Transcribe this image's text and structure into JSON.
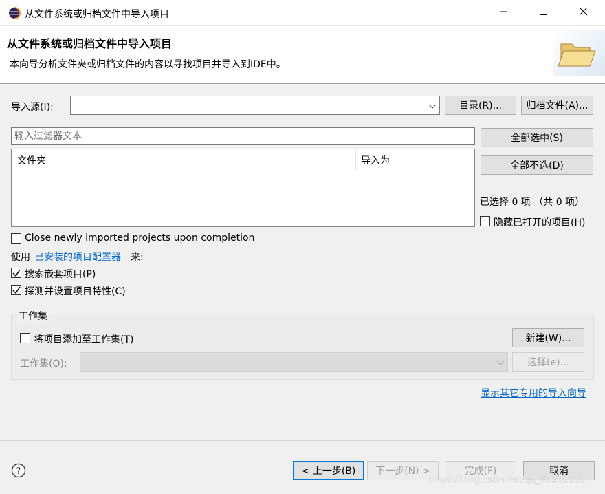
{
  "window": {
    "title": "从文件系统或归档文件中导入项目",
    "minimize_label": "minimize-icon",
    "maximize_label": "maximize-icon",
    "close_label": "close-icon"
  },
  "header": {
    "title": "从文件系统或归档文件中导入项目",
    "description": "本向导分析文件夹或归档文件的内容以寻找项目并导入到IDE中。"
  },
  "import_source": {
    "label": "导入源(I):",
    "value": "",
    "directory_button": "目录(R)...",
    "archive_button": "归档文件(A)..."
  },
  "filter": {
    "placeholder": "输入过滤器文本"
  },
  "table": {
    "columns": [
      "文件夹",
      "导入为"
    ],
    "rows": []
  },
  "selection": {
    "select_all": "全部选中(S)",
    "deselect_all": "全部不选(D)",
    "status": "已选择 0 项 （共 0 项）",
    "hide_open_label": "隐藏已打开的项目(H)",
    "hide_open_checked": false
  },
  "options": {
    "close_imported_label": "Close newly imported projects upon completion",
    "close_imported_checked": false,
    "use_prefix": "使用",
    "configurators_link": "已安装的项目配置器",
    "use_suffix": "来:",
    "search_nested_label": "搜索嵌套项目(P)",
    "search_nested_checked": true,
    "detect_config_label": "探测并设置项目特性(C)",
    "detect_config_checked": true
  },
  "working_sets": {
    "group_title": "工作集",
    "add_label": "将项目添加至工作集(T)",
    "add_checked": false,
    "new_button": "新建(W)...",
    "sets_label": "工作集(O):",
    "select_button": "选择(e)..."
  },
  "other_wizards_link": "显示其它专用的导入向导",
  "footer": {
    "back_button": "< 上一步(B)",
    "next_button": "下一步(N) >",
    "finish_button": "完成(F)",
    "cancel_button": "取消",
    "watermark": "https://blog.csdn.net/qq_43242216"
  },
  "colors": {
    "accent": "#0078d7",
    "link": "#0066cc"
  }
}
